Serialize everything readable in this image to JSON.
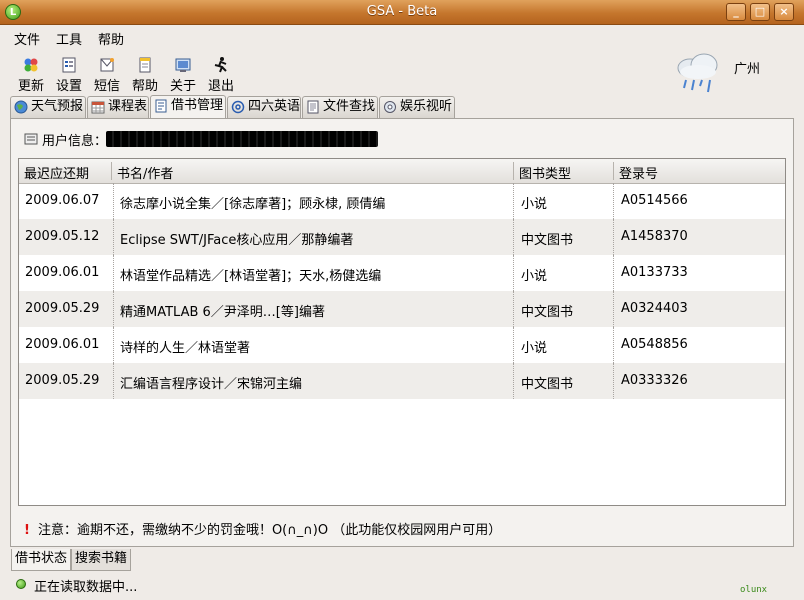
{
  "window": {
    "title": "GSA - Beta"
  },
  "menu": [
    "文件",
    "工具",
    "帮助"
  ],
  "toolbar": [
    {
      "label": "更新",
      "icon": "update-icon"
    },
    {
      "label": "设置",
      "icon": "settings-icon"
    },
    {
      "label": "短信",
      "icon": "sms-icon"
    },
    {
      "label": "帮助",
      "icon": "help-icon"
    },
    {
      "label": "关于",
      "icon": "about-icon"
    },
    {
      "label": "退出",
      "icon": "exit-icon"
    }
  ],
  "weather": {
    "city": "广州",
    "icon": "rain-cloud-icon"
  },
  "tabs": [
    "天气预报",
    "课程表",
    "借书管理",
    "四六英语",
    "文件查找",
    "娱乐视听"
  ],
  "active_tab": "借书管理",
  "user_info_label": "用户信息：",
  "table": {
    "headers": [
      "最迟应还期",
      "书名/作者",
      "图书类型",
      "登录号"
    ],
    "rows": [
      [
        "2009.06.07",
        "徐志摩小说全集／[徐志摩著]；顾永棣, 顾倩编",
        "小说",
        "A0514566"
      ],
      [
        "2009.05.12",
        "Eclipse SWT/JFace核心应用／那静编著",
        "中文图书",
        "A1458370"
      ],
      [
        "2009.06.01",
        "林语堂作品精选／[林语堂著]；天水,杨健选编",
        "小说",
        "A0133733"
      ],
      [
        "2009.05.29",
        "精通MATLAB 6／尹泽明…[等]编著",
        "中文图书",
        "A0324403"
      ],
      [
        "2009.06.01",
        "诗样的人生／林语堂著",
        "小说",
        "A0548856"
      ],
      [
        "2009.05.29",
        "汇编语言程序设计／宋锦河主编",
        "中文图书",
        "A0333326"
      ]
    ]
  },
  "note": "注意：逾期不还，需缴纳不少的罚金哦！O(∩_∩)O （此功能仅校园网用户可用）",
  "bottom_tabs": [
    "借书状态",
    "搜索书籍"
  ],
  "status": "正在读取数据中...",
  "brand": "olunx",
  "colors": {
    "titlebar": "#c5762d",
    "warning": "#dd1111"
  }
}
